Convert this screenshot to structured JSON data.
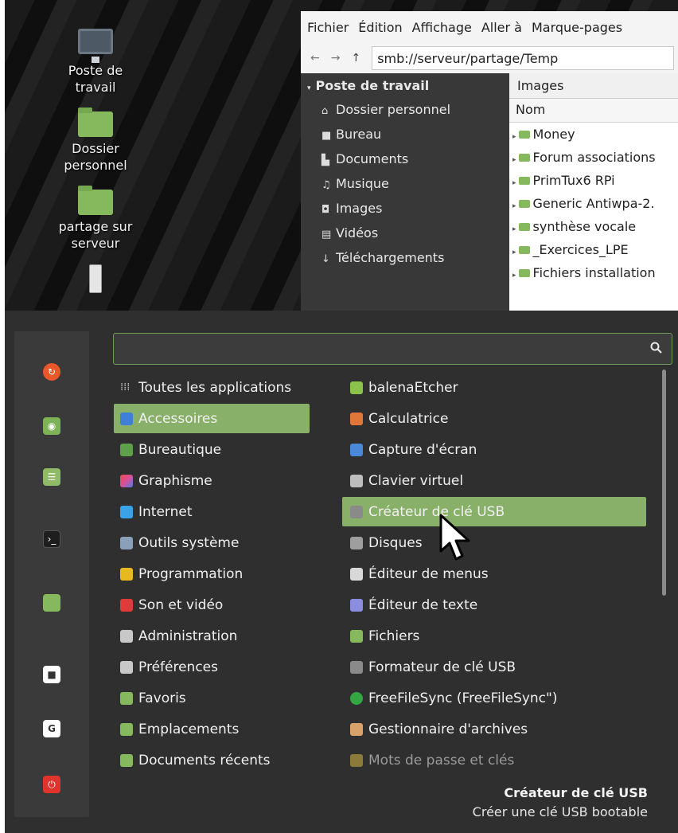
{
  "desktop": {
    "icons": [
      {
        "label_line1": "Poste de",
        "label_line2": "travail",
        "icon": "computer-icon"
      },
      {
        "label_line1": "Dossier",
        "label_line2": "personnel",
        "icon": "home-folder-icon"
      },
      {
        "label_line1": "partage sur",
        "label_line2": "serveur",
        "icon": "network-folder-icon"
      },
      {
        "label_line1": "",
        "label_line2": "",
        "icon": "usb-drive-icon"
      }
    ]
  },
  "file_manager": {
    "menubar": [
      "Fichier",
      "Édition",
      "Affichage",
      "Aller à",
      "Marque-pages"
    ],
    "toolbar": {
      "back": "←",
      "forward": "→",
      "up": "↑",
      "path": "smb://serveur/partage/Temp"
    },
    "sidebar": {
      "heading": "Poste de travail",
      "items": [
        {
          "label": "Dossier personnel",
          "icon": "home-icon",
          "glyph": "⌂"
        },
        {
          "label": "Bureau",
          "icon": "desktop-icon",
          "glyph": "■"
        },
        {
          "label": "Documents",
          "icon": "document-icon",
          "glyph": "▙"
        },
        {
          "label": "Musique",
          "icon": "music-icon",
          "glyph": "♫"
        },
        {
          "label": "Images",
          "icon": "camera-icon",
          "glyph": "◘"
        },
        {
          "label": "Vidéos",
          "icon": "video-icon",
          "glyph": "▤"
        },
        {
          "label": "Téléchargements",
          "icon": "download-icon",
          "glyph": "↓"
        }
      ]
    },
    "main": {
      "location": "Images",
      "column_header": "Nom",
      "rows": [
        "Money",
        "Forum associations",
        "PrimTux6 RPi",
        "Generic Antiwpa-2.",
        "synthèse vocale",
        "_Exercices_LPE",
        "Fichiers installation"
      ]
    }
  },
  "menu": {
    "search": {
      "placeholder": "",
      "value": ""
    },
    "favorites": [
      {
        "name": "firefox-icon",
        "color": "#e8582a"
      },
      {
        "name": "software-manager-icon",
        "color": "#7cb357"
      },
      {
        "name": "system-settings-icon",
        "color": "#8fbb66"
      },
      {
        "name": "terminal-icon",
        "color": "#1e1e1e"
      },
      {
        "name": "files-icon",
        "color": "#86b95d"
      },
      {
        "name": "lock-screen-icon",
        "color": "#ffffff"
      },
      {
        "name": "logout-icon",
        "color": "#ffffff"
      },
      {
        "name": "power-icon",
        "color": "#e0332c"
      }
    ],
    "categories": [
      {
        "label": "Toutes les applications",
        "color": "#bbbbbb"
      },
      {
        "label": "Accessoires",
        "color": "#3f7fd6"
      },
      {
        "label": "Bureautique",
        "color": "#5fa04a"
      },
      {
        "label": "Graphisme",
        "color": "#d94f9b"
      },
      {
        "label": "Internet",
        "color": "#3aa3e8"
      },
      {
        "label": "Outils système",
        "color": "#8aa0b8"
      },
      {
        "label": "Programmation",
        "color": "#e6b91f"
      },
      {
        "label": "Son et vidéo",
        "color": "#e03b3b"
      },
      {
        "label": "Administration",
        "color": "#c8c8c8"
      },
      {
        "label": "Préférences",
        "color": "#c8c8c8"
      },
      {
        "label": "Favoris",
        "color": "#86b95d"
      },
      {
        "label": "Emplacements",
        "color": "#86b95d"
      },
      {
        "label": "Documents récents",
        "color": "#86b95d"
      }
    ],
    "selected_category": "Accessoires",
    "apps": [
      {
        "label": "balenaEtcher",
        "color": "#8bc34a"
      },
      {
        "label": "Calculatrice",
        "color": "#e0763a"
      },
      {
        "label": "Capture d'écran",
        "color": "#4a88d8"
      },
      {
        "label": "Clavier virtuel",
        "color": "#bdbdbd"
      },
      {
        "label": "Créateur de clé USB",
        "color": "#8a8a8a"
      },
      {
        "label": "Disques",
        "color": "#9e9e9e"
      },
      {
        "label": "Éditeur de menus",
        "color": "#d8d8d8"
      },
      {
        "label": "Éditeur de texte",
        "color": "#8c8ce0"
      },
      {
        "label": "Fichiers",
        "color": "#86b95d"
      },
      {
        "label": "Formateur de clé USB",
        "color": "#8a8a8a"
      },
      {
        "label": "FreeFileSync (FreeFileSync\")",
        "color": "#33a842"
      },
      {
        "label": "Gestionnaire d'archives",
        "color": "#d8a26a"
      },
      {
        "label": "Mots de passe et clés",
        "color": "#8c7a3a"
      }
    ],
    "selected_app": "Créateur de clé USB",
    "description": {
      "title": "Créateur de clé USB",
      "subtitle": "Créer une clé USB bootable"
    }
  }
}
